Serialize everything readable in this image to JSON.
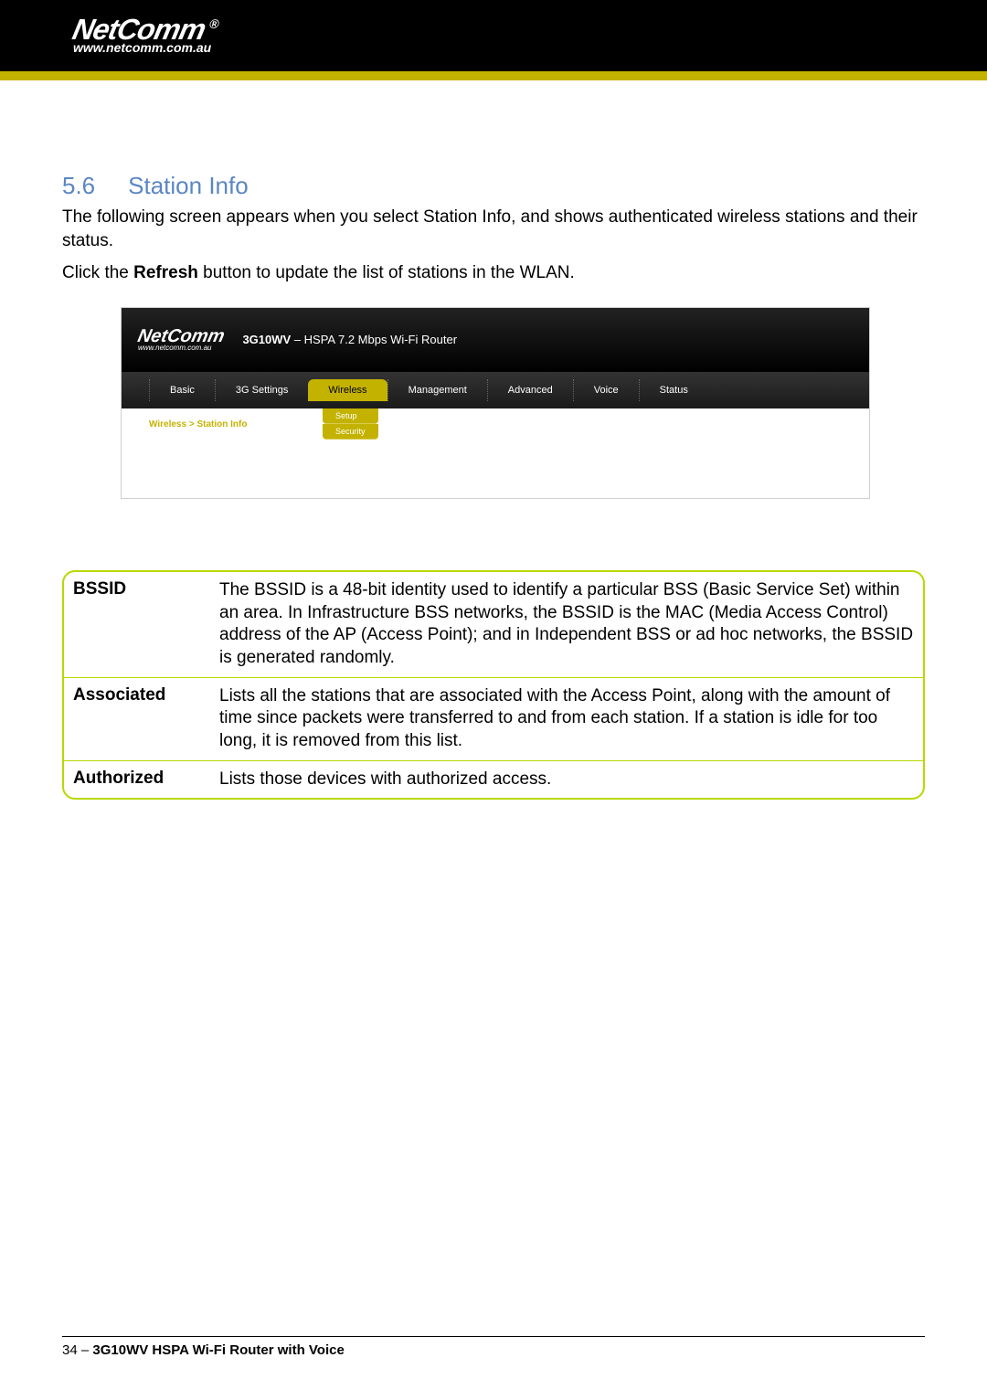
{
  "header": {
    "logo_text": "NetComm",
    "logo_reg": "®",
    "url": "www.netcomm.com.au"
  },
  "section": {
    "number": "5.6",
    "title": "Station Info",
    "para1": "The following screen appears when you select Station Info, and shows authenticated wireless stations and their status.",
    "para2_pre": "Click the ",
    "para2_bold": "Refresh",
    "para2_post": " button to update the list of stations in the WLAN."
  },
  "router": {
    "logo": "NetComm",
    "logo_url": "www.netcomm.com.au",
    "title_bold": "3G10WV",
    "title_rest": " – HSPA 7.2 Mbps Wi-Fi Router",
    "nav": [
      "Basic",
      "3G Settings",
      "Wireless",
      "Management",
      "Advanced",
      "Voice",
      "Status"
    ],
    "nav_active_index": 2,
    "sub_nav": [
      "Setup",
      "Security"
    ],
    "breadcrumb": "Wireless > Station Info"
  },
  "definitions": [
    {
      "term": "BSSID",
      "desc": "The BSSID is a 48-bit identity used to identify a particular BSS (Basic Service Set) within an area. In Infrastructure BSS networks, the BSSID is the MAC (Media Access Control) address of the AP (Access Point); and in Independent BSS or ad hoc networks, the BSSID is generated randomly."
    },
    {
      "term": "Associated",
      "desc": "Lists all the stations that are associated with the Access Point, along with the amount of time since packets were transferred to and from each station. If a station is idle for too long, it is removed from this list."
    },
    {
      "term": "Authorized",
      "desc": "Lists those devices with authorized access."
    }
  ],
  "footer": {
    "page": "34",
    "sep": " – ",
    "model": "3G10WV HSPA Wi-Fi Router with Voice"
  }
}
